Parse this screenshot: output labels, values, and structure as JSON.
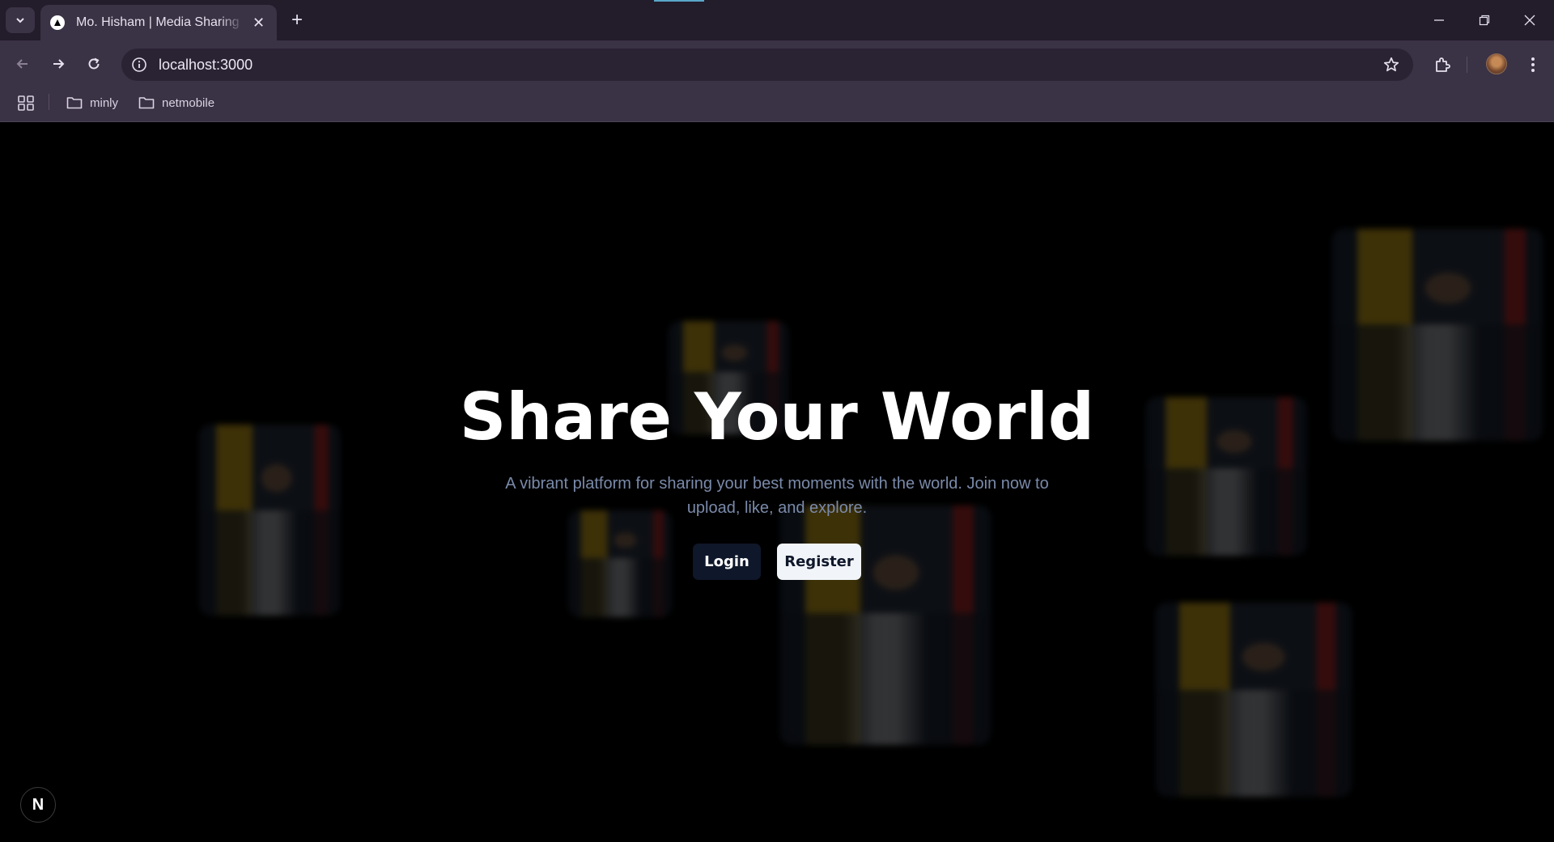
{
  "browser": {
    "tab_title": "Mo. Hisham | Media Sharing Platform",
    "tab_close": "✕",
    "new_tab": "+",
    "url": "localhost:3000",
    "bookmarks": [
      {
        "label": "minly"
      },
      {
        "label": "netmobile"
      }
    ]
  },
  "hero": {
    "title": "Share Your World",
    "subtitle": "A vibrant platform for sharing your best moments with the world. Join now to upload, like, and explore.",
    "login_label": "Login",
    "register_label": "Register"
  },
  "badge": {
    "letter": "N"
  },
  "colors": {
    "page_background": "#000000",
    "login_button": "#0f172a",
    "register_button": "#f1f5f9",
    "subtitle_text": "#7a8aaa"
  }
}
